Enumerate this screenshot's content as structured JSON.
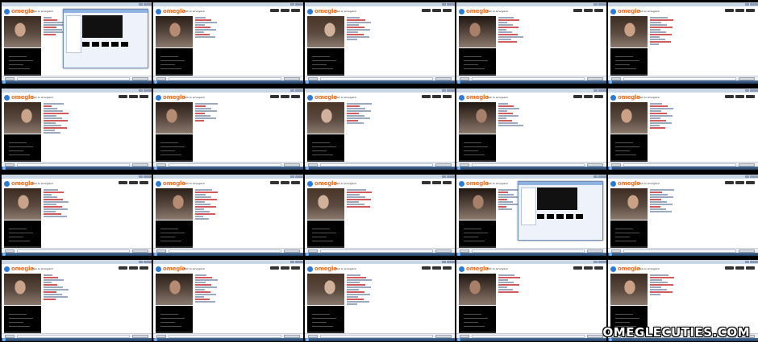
{
  "app": {
    "logo_text": "omegle",
    "tagline": "Talk to strangers!"
  },
  "grid": {
    "rows": 4,
    "cols": 5
  },
  "dialog_thumbs": [
    0,
    13
  ],
  "watermark": "OMEGLECUTIES.COM",
  "colors": {
    "omegle_orange": "#f26c1a",
    "omegle_blue": "#2a7bd6"
  }
}
